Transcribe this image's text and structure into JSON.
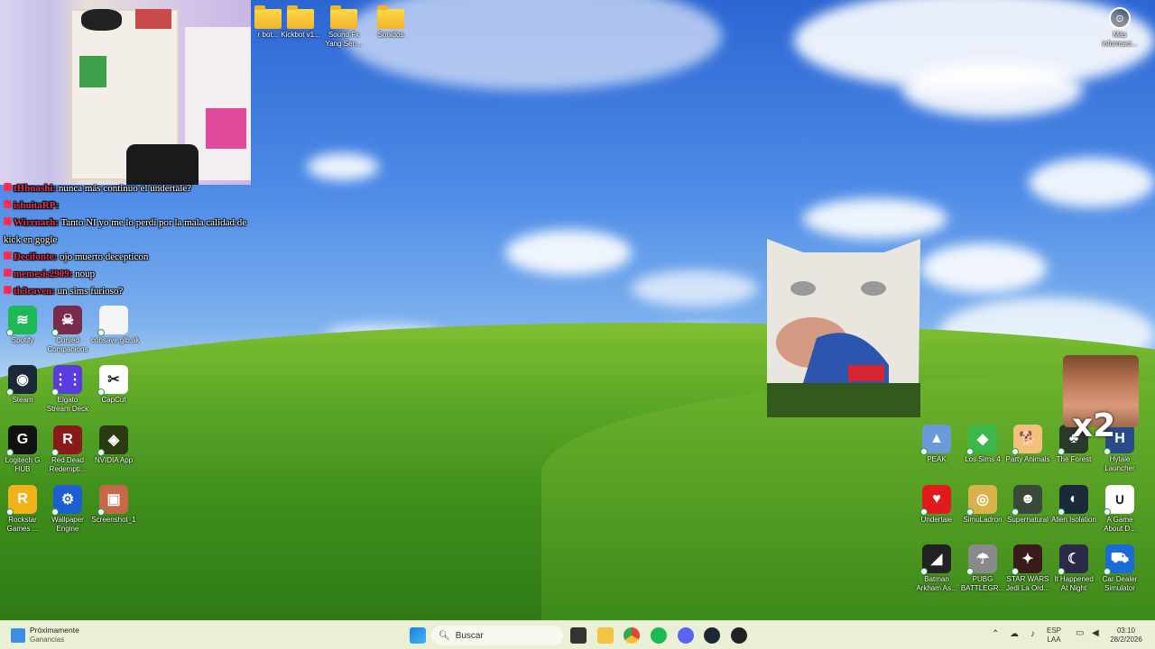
{
  "wallpaper": {
    "sky": "#3a78d8",
    "grass": "#58a526"
  },
  "chat": [
    {
      "user": "tHbnashi:",
      "msg": " nunca más continuo el undertale?"
    },
    {
      "user": "ishuitaRP:",
      "msg": ""
    },
    {
      "user": "Wirrnarh:",
      "msg": " Tanto NI yo me lo perdí por la mala calidad de kick en gogle"
    },
    {
      "user": "Decifonte:",
      "msg": " ojo muerto decepticon"
    },
    {
      "user": "memesis2909:",
      "msg": " noup"
    },
    {
      "user": "th3raven:",
      "msg": " un sims furioso?"
    }
  ],
  "top_icons": [
    {
      "label": "r bot..."
    },
    {
      "label": "Kickbot v1..."
    },
    {
      "label": "Sound Fx Yang Sen..."
    },
    {
      "label": "Sonidos"
    }
  ],
  "info_icon": {
    "label": "Más informaci..."
  },
  "left_icons": [
    {
      "label": "Spotify",
      "color": "#1db954",
      "glyph": "≋"
    },
    {
      "label": "Cursed Companions",
      "color": "#7a2a4a",
      "glyph": "☠"
    },
    {
      "label": "consave.glb.ak",
      "color": "#f4f4f4",
      "glyph": ""
    },
    {
      "label": "Steam",
      "color": "#1b2838",
      "glyph": "◉"
    },
    {
      "label": "Elgato Stream Deck",
      "color": "#5a3be0",
      "glyph": "⋮⋮"
    },
    {
      "label": "CapCut",
      "color": "#ffffff",
      "glyph": "✂"
    },
    {
      "label": "Logitech G HUB",
      "color": "#111111",
      "glyph": "G"
    },
    {
      "label": "Red Dead Redempti...",
      "color": "#8a1a1a",
      "glyph": "R"
    },
    {
      "label": "NVIDIA App",
      "color": "#2a3b12",
      "glyph": "◈"
    },
    {
      "label": "Rockstar Games ...",
      "color": "#f2b21a",
      "glyph": "R"
    },
    {
      "label": "Wallpaper Engine",
      "color": "#1d5fd3",
      "glyph": "⚙"
    },
    {
      "label": "Screenshot_1",
      "color": "#c46a4a",
      "glyph": "▣"
    }
  ],
  "right_icons": [
    {
      "label": "PEAK",
      "color": "#6a9ad8",
      "glyph": "▲"
    },
    {
      "label": "Los Sims 4",
      "color": "#3cb84a",
      "glyph": "◆"
    },
    {
      "label": "Party Animals",
      "color": "#f2c07a",
      "glyph": "🐕"
    },
    {
      "label": "The Forest",
      "color": "#2a3a2a",
      "glyph": "♣"
    },
    {
      "label": "Hytale Launcher",
      "color": "#2a4a8a",
      "glyph": "H"
    },
    {
      "label": "Undertale",
      "color": "#e11b1b",
      "glyph": "♥"
    },
    {
      "label": "SimuLadron",
      "color": "#d8b24a",
      "glyph": "◎"
    },
    {
      "label": "Supernatural",
      "color": "#3a4a3a",
      "glyph": "☻"
    },
    {
      "label": "Alien Isolation",
      "color": "#1a2a3a",
      "glyph": "◐"
    },
    {
      "label": "A Game About D...",
      "color": "#ffffff",
      "glyph": "∪"
    },
    {
      "label": "Batman Arkham As...",
      "color": "#222222",
      "glyph": "◢"
    },
    {
      "label": "PUBG BATTLEGR...",
      "color": "#8a8a8a",
      "glyph": "☂"
    },
    {
      "label": "STAR WARS Jedi La Ord...",
      "color": "#3a1a1a",
      "glyph": "✦"
    },
    {
      "label": "It Happened At Night",
      "color": "#2a2a4a",
      "glyph": "☾"
    },
    {
      "label": "Car Dealer Simulator",
      "color": "#1a6ad8",
      "glyph": "⛟"
    }
  ],
  "meme_text": "x2",
  "taskbar": {
    "widget_title": "Próximamente",
    "widget_sub": "Ganancias",
    "search_placeholder": "Buscar",
    "lang1": "ESP",
    "lang2": "LAA",
    "time": "03:10",
    "date": "28/2/2026"
  }
}
